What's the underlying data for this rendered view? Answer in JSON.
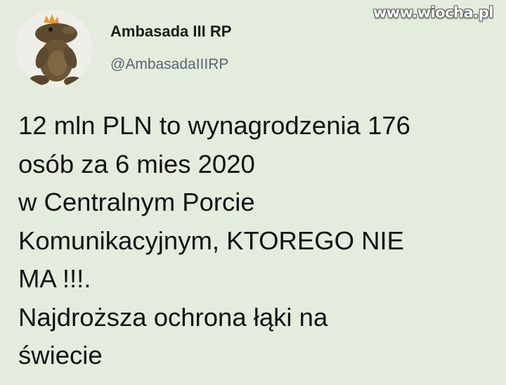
{
  "watermark": "www.wiocha.pl",
  "tweet": {
    "author": {
      "display_name": "Ambasada III RP",
      "handle": "@AmbasadaIIIRP",
      "avatar_icon": "frog-toy-with-crown-avatar"
    },
    "text_lines": [
      "12 mln PLN to wynagrodzenia 176",
      "osób za 6 mies 2020",
      "w Centralnym Porcie",
      "Komunikacyjnym, KTOREGO NIE",
      "MA !!!.",
      "Najdroższa ochrona łąki na",
      "świecie"
    ]
  },
  "colors": {
    "background": "#e4ecdd",
    "handle": "#5b6570",
    "text": "#121212"
  }
}
